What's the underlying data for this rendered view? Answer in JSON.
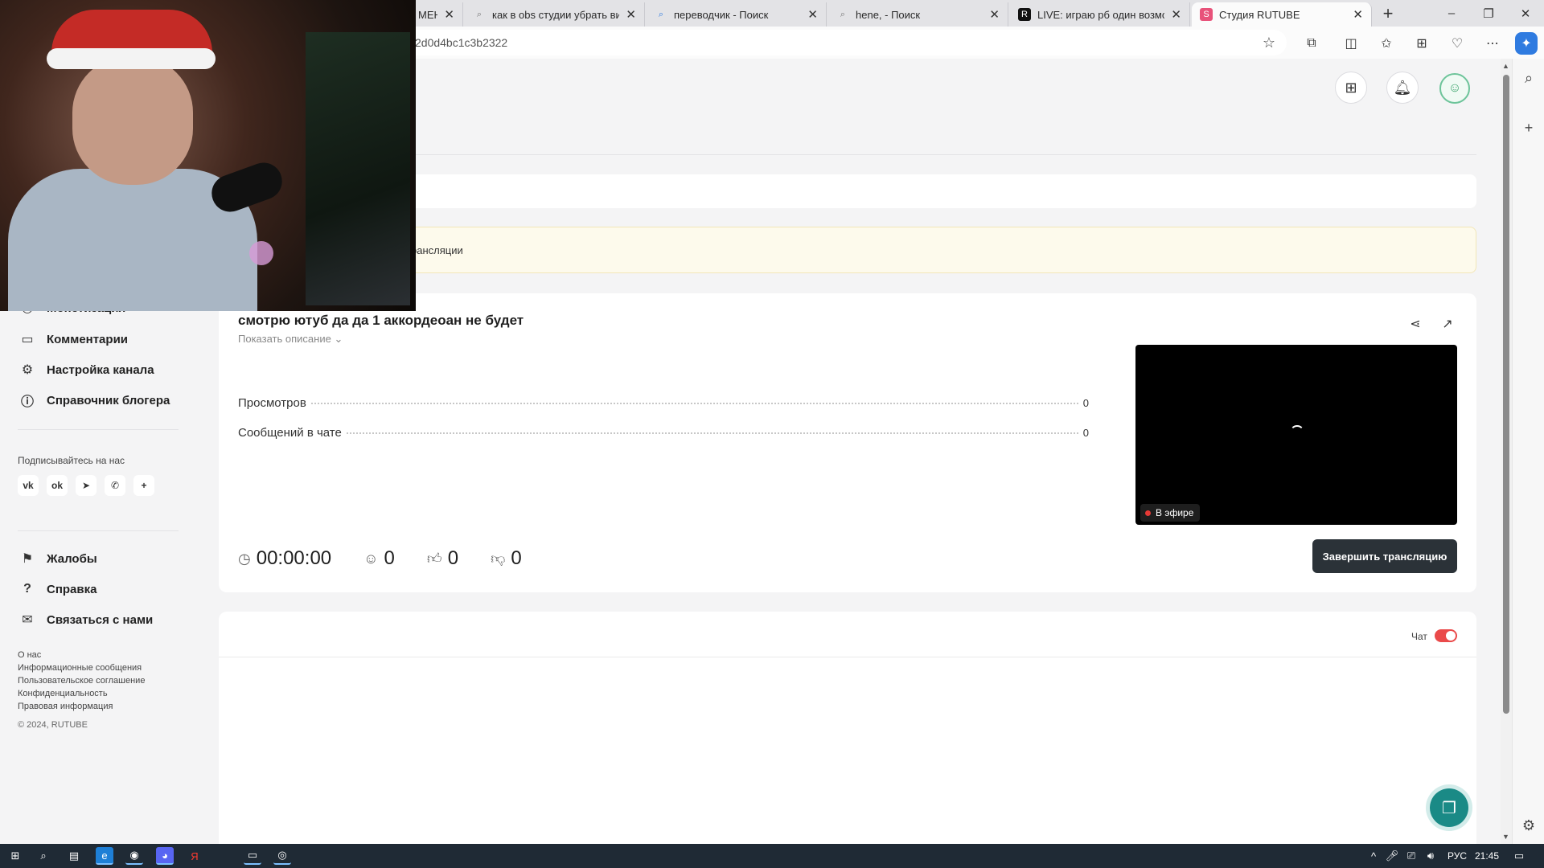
{
  "browser": {
    "tabs": [
      {
        "title": "МЕНЯ",
        "favicon": ""
      },
      {
        "title": "как в obs студии убрать вид с",
        "favicon": "search-icon"
      },
      {
        "title": "переводчик - Поиск",
        "favicon": "search-icon"
      },
      {
        "title": "hene, - Поиск",
        "favicon": "search-icon"
      },
      {
        "title": "LIVE: играю рб один возможно",
        "favicon": "rutube-icon"
      },
      {
        "title": "Студия RUTUBE",
        "favicon": "rutube-studio-icon"
      }
    ],
    "url": "2d0d4bc1c3b2322",
    "new_tab": "+"
  },
  "page": {
    "warning_text": "рансляции"
  },
  "nav": {
    "items_top": [
      {
        "label": "Монетизация"
      },
      {
        "label": "Комментарии"
      },
      {
        "label": "Настройка канала"
      },
      {
        "label": "Справочник блогера"
      }
    ],
    "follow_label": "Подписывайтесь на нас",
    "socials": [
      "vk",
      "ok",
      "telegram",
      "viber",
      "+"
    ],
    "items_bottom": [
      {
        "label": "Жалобы"
      },
      {
        "label": "Справка"
      },
      {
        "label": "Связаться с нами"
      }
    ],
    "footer_links": [
      "О нас",
      "Информационные сообщения",
      "Пользовательское соглашение",
      "Конфиденциальность",
      "Правовая информация"
    ],
    "copyright": "© 2024, RUTUBE"
  },
  "stream": {
    "title": "смотрю ютуб да да 1 аккордеоан не будет",
    "show_description": "Показать описание",
    "stats": [
      {
        "label": "Просмотров",
        "value": "0"
      },
      {
        "label": "Сообщений в чате",
        "value": "0"
      }
    ],
    "live_badge": "В эфире",
    "duration": "00:00:00",
    "viewers": "0",
    "likes": "0",
    "dislikes": "0",
    "end_button": "Завершить трансляцию"
  },
  "chat": {
    "label": "Чат",
    "enabled": true
  },
  "taskbar": {
    "lang": "РУС",
    "time": "21:45"
  },
  "colors": {
    "accent_red": "#ea4a4a",
    "end_button": "#2b3238",
    "fab": "#1a8a86",
    "live_dot": "#e53935"
  }
}
